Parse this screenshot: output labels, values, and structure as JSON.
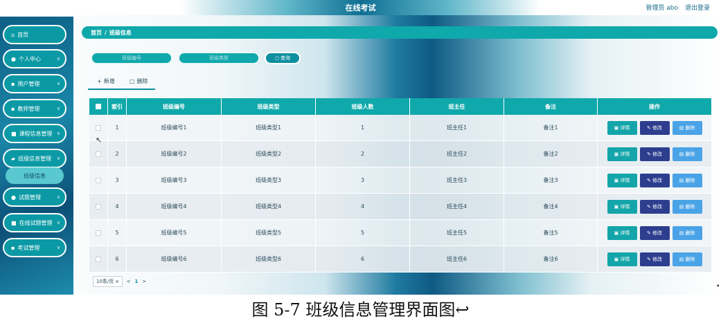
{
  "header": {
    "title": "在线考试",
    "user_label": "管理员 abo",
    "logout_label": "退出登录"
  },
  "sidebar": {
    "items": [
      {
        "label": "首页",
        "icon": "home-icon",
        "glyph": "⌂",
        "chevron": false
      },
      {
        "label": "个人中心",
        "icon": "user-icon",
        "glyph": "●",
        "chevron": true
      },
      {
        "label": "用户管理",
        "icon": "grid-icon",
        "glyph": "▪",
        "chevron": true
      },
      {
        "label": "教师管理",
        "icon": "grid-icon",
        "glyph": "▪",
        "chevron": true
      },
      {
        "label": "课程信息管理",
        "icon": "book-icon",
        "glyph": "■",
        "chevron": true
      },
      {
        "label": "班级信息管理",
        "icon": "folder-icon",
        "glyph": "▰",
        "chevron": true
      },
      {
        "label": "试题管理",
        "icon": "bulb-icon",
        "glyph": "●",
        "chevron": true
      },
      {
        "label": "在线试题管理",
        "icon": "card-icon",
        "glyph": "■",
        "chevron": true
      },
      {
        "label": "考试管理",
        "icon": "grid-icon",
        "glyph": "▪",
        "chevron": true
      }
    ],
    "submenu_active": "班级信息"
  },
  "breadcrumb": {
    "home": "首页",
    "separator": "/",
    "current": "班级信息"
  },
  "search": {
    "class_no_placeholder": "班级编号",
    "class_type_placeholder": "班级类型",
    "query_label": "查询"
  },
  "toolbar": {
    "add_label": "新增",
    "delete_label": "删除"
  },
  "table": {
    "columns": [
      "",
      "索引",
      "班级编号",
      "班级类型",
      "班级人数",
      "班主任",
      "备注",
      "操作"
    ],
    "rows": [
      {
        "index": "1",
        "class_no": "班级编号1",
        "class_type": "班级类型1",
        "count": "1",
        "teacher": "班主任1",
        "note": "备注1"
      },
      {
        "index": "2",
        "class_no": "班级编号2",
        "class_type": "班级类型2",
        "count": "2",
        "teacher": "班主任2",
        "note": "备注2"
      },
      {
        "index": "3",
        "class_no": "班级编号3",
        "class_type": "班级类型3",
        "count": "3",
        "teacher": "班主任3",
        "note": "备注3"
      },
      {
        "index": "4",
        "class_no": "班级编号4",
        "class_type": "班级类型4",
        "count": "4",
        "teacher": "班主任4",
        "note": "备注4"
      },
      {
        "index": "5",
        "class_no": "班级编号5",
        "class_type": "班级类型5",
        "count": "5",
        "teacher": "班主任5",
        "note": "备注5"
      },
      {
        "index": "6",
        "class_no": "班级编号6",
        "class_type": "班级类型6",
        "count": "6",
        "teacher": "班主任6",
        "note": "备注6"
      }
    ],
    "actions": {
      "detail": "详情",
      "edit": "修改",
      "delete": "删除"
    }
  },
  "pagination": {
    "page_size": "10条/页",
    "prev": "<",
    "current_page": "1",
    "next": ">"
  },
  "caption": "图 5-7 班级信息管理界面图↩",
  "colors": {
    "accent": "#0fa8ab",
    "edit": "#2d3e8f",
    "delete": "#4aa3e6"
  }
}
